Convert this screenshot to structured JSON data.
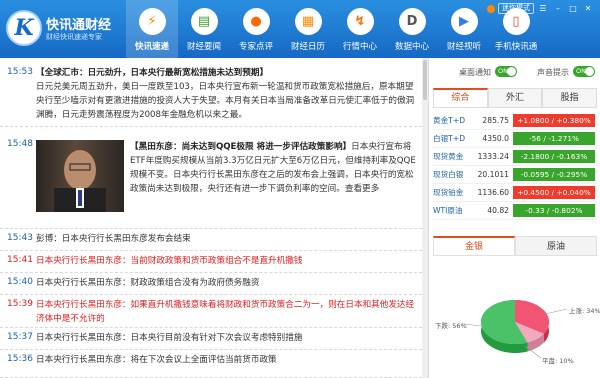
{
  "app": {
    "name": "快讯通财经",
    "slogan": "财经快讯速递专家"
  },
  "window": {
    "mini_mode": "迷你模式"
  },
  "nav": [
    {
      "label": "快讯速递",
      "icon": "lightning-icon",
      "glyph": "⚡",
      "color": "#ff8a00",
      "active": true
    },
    {
      "label": "财经要闻",
      "icon": "newspaper-icon",
      "glyph": "▤",
      "color": "#3aa52c",
      "active": false
    },
    {
      "label": "专家点评",
      "icon": "expert-icon",
      "glyph": "●",
      "color": "#ff6a00",
      "active": false
    },
    {
      "label": "财经日历",
      "icon": "calendar-icon",
      "glyph": "▦",
      "color": "#ff8a00",
      "active": false
    },
    {
      "label": "行情中心",
      "icon": "chart-icon",
      "glyph": "↯",
      "color": "#ff6a00",
      "active": false
    },
    {
      "label": "数据中心",
      "icon": "data-icon",
      "glyph": "D",
      "color": "#555555",
      "active": false
    },
    {
      "label": "财经视听",
      "icon": "video-icon",
      "glyph": "▶",
      "color": "#3a7de0",
      "active": false
    },
    {
      "label": "手机快讯通",
      "icon": "mobile-icon",
      "glyph": "▯",
      "color": "#e44c1b",
      "active": false
    }
  ],
  "news": [
    {
      "time": "15:53",
      "headline": "【全球汇市：日元劲升，日本央行最新宽松措施未达到预期】",
      "body": "日元兑美元周五劲升，美日一度跌至103，日本央行宣布新一轮温和货币政策宽松措施后，原本期望央行至少嗑示对有更激进措施的投资人大于失望。本月有关日本当局准备改革日元使汇率低于的傲洞渊腾，日元走势震荡程度为2008年金融危机以来之最。",
      "red": false
    },
    {
      "time": "15:48",
      "headline": "【黑田东彦：尚未达到QQE极限 将进一步评估政策影响】",
      "body": "日本央行宣布将ETF年度购买规模从当前3.3万亿日元扩大至6万亿日元，但维持利率及QQE规模不变。日本央行行长黑田东彦在之后的发布会上强调，日本央行的宽松政策尚未达到极限，央行还有进一步下调负利率的空间。查看更多",
      "red": false,
      "has_photo": true
    },
    {
      "time": "15:43",
      "headline": "",
      "body": "彭博：日本央行行长黑田东彦发布会结束",
      "red": false
    },
    {
      "time": "15:41",
      "headline": "",
      "body": "日本央行行长黑田东彦：当前财政政策和货币政策组合不是直升机撒钱",
      "red": true
    },
    {
      "time": "15:40",
      "headline": "",
      "body": "日本央行行长黑田东彦：财政政策组合没有为政府债务融资",
      "red": false
    },
    {
      "time": "15:39",
      "headline": "",
      "body": "日本央行行长黑田东彦：如果直升机撒钱意味着将财政和货币政策合二为一，则在日本和其他发达经济体中是不允许的",
      "red": true
    },
    {
      "time": "15:37",
      "headline": "",
      "body": "日本央行行长黑田东彦：日本央行目前没有针对下次会议考虑特别措施",
      "red": false
    },
    {
      "time": "15:36",
      "headline": "",
      "body": "日本央行行长黑田东彦：将在下次会议上全面评估当前货币政策",
      "red": false
    }
  ],
  "right": {
    "toggle_desktop": "桌面通知",
    "toggle_sound": "声音提示",
    "toggle_on": "ON",
    "tabs": [
      "综合",
      "外汇",
      "股指"
    ],
    "quotes": [
      {
        "name": "黄金T+D",
        "price": "285.75",
        "change": "+1.0800 / +0.380%",
        "dir": "up"
      },
      {
        "name": "白银T+D",
        "price": "4350.0",
        "change": "-56 / -1.271%",
        "dir": "down"
      },
      {
        "name": "现货黄金",
        "price": "1333.24",
        "change": "-2.1800 / -0.163%",
        "dir": "down"
      },
      {
        "name": "现货白银",
        "price": "20.1011",
        "change": "-0.0595 / -0.295%",
        "dir": "down"
      },
      {
        "name": "现货铂金",
        "price": "1136.60",
        "change": "+0.4500 / +0.040%",
        "dir": "up"
      },
      {
        "name": "WTI原油",
        "price": "40.82",
        "change": "-0.33 / -0.802%",
        "dir": "down"
      }
    ],
    "tabs2": [
      "金银",
      "原油"
    ],
    "pie": {
      "up_label": "上涨: 34%",
      "down_label": "下跌: 56%",
      "flat_label": "平盘: 10%",
      "up": 34,
      "down": 56,
      "flat": 10,
      "colors": {
        "up": "#f25573",
        "down": "#4ac267",
        "flat": "#f4a9c1"
      }
    }
  },
  "colors": {
    "header": "#1a74cc",
    "up": "#ef3b2c",
    "down": "#3aa52c",
    "accent": "#e44c1b"
  }
}
